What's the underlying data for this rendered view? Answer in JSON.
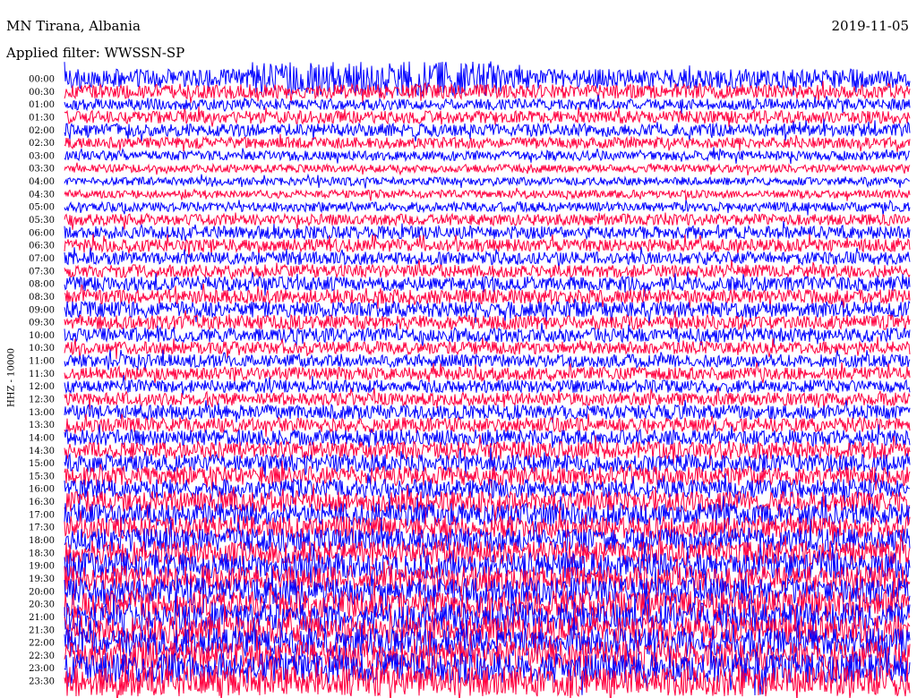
{
  "header": {
    "station": "MN Tirana, Albania",
    "filter": "Applied filter: WWSSN-SP",
    "date": "2019-11-05"
  },
  "chart_data": {
    "type": "line",
    "title": "MN Tirana, Albania",
    "subtitle": "Applied filter: WWSSN-SP",
    "date": "2019-11-05",
    "ylabel": "HHZ - 10000",
    "colors": [
      "#0000ff",
      "#ff0040"
    ],
    "rows": [
      {
        "label": "00:00",
        "amplitude": 0.6
      },
      {
        "label": "00:30",
        "amplitude": 0.45
      },
      {
        "label": "01:00",
        "amplitude": 0.35
      },
      {
        "label": "01:30",
        "amplitude": 0.4
      },
      {
        "label": "02:00",
        "amplitude": 0.4
      },
      {
        "label": "02:30",
        "amplitude": 0.35
      },
      {
        "label": "03:00",
        "amplitude": 0.3
      },
      {
        "label": "03:30",
        "amplitude": 0.25
      },
      {
        "label": "04:00",
        "amplitude": 0.25
      },
      {
        "label": "04:30",
        "amplitude": 0.25
      },
      {
        "label": "05:00",
        "amplitude": 0.3
      },
      {
        "label": "05:30",
        "amplitude": 0.35
      },
      {
        "label": "06:00",
        "amplitude": 0.4
      },
      {
        "label": "06:30",
        "amplitude": 0.4
      },
      {
        "label": "07:00",
        "amplitude": 0.4
      },
      {
        "label": "07:30",
        "amplitude": 0.4
      },
      {
        "label": "08:00",
        "amplitude": 0.45
      },
      {
        "label": "08:30",
        "amplitude": 0.45
      },
      {
        "label": "09:00",
        "amplitude": 0.5
      },
      {
        "label": "09:30",
        "amplitude": 0.45
      },
      {
        "label": "10:00",
        "amplitude": 0.45
      },
      {
        "label": "10:30",
        "amplitude": 0.4
      },
      {
        "label": "11:00",
        "amplitude": 0.4
      },
      {
        "label": "11:30",
        "amplitude": 0.4
      },
      {
        "label": "12:00",
        "amplitude": 0.4
      },
      {
        "label": "12:30",
        "amplitude": 0.4
      },
      {
        "label": "13:00",
        "amplitude": 0.45
      },
      {
        "label": "13:30",
        "amplitude": 0.45
      },
      {
        "label": "14:00",
        "amplitude": 0.5
      },
      {
        "label": "14:30",
        "amplitude": 0.55
      },
      {
        "label": "15:00",
        "amplitude": 0.55
      },
      {
        "label": "15:30",
        "amplitude": 0.6
      },
      {
        "label": "16:00",
        "amplitude": 0.6
      },
      {
        "label": "16:30",
        "amplitude": 0.65
      },
      {
        "label": "17:00",
        "amplitude": 0.7
      },
      {
        "label": "17:30",
        "amplitude": 0.7
      },
      {
        "label": "18:00",
        "amplitude": 0.75
      },
      {
        "label": "18:30",
        "amplitude": 0.75
      },
      {
        "label": "19:00",
        "amplitude": 0.8
      },
      {
        "label": "19:30",
        "amplitude": 0.8
      },
      {
        "label": "20:00",
        "amplitude": 0.85
      },
      {
        "label": "20:30",
        "amplitude": 0.85
      },
      {
        "label": "21:00",
        "amplitude": 0.9
      },
      {
        "label": "21:30",
        "amplitude": 0.9
      },
      {
        "label": "22:00",
        "amplitude": 0.9
      },
      {
        "label": "22:30",
        "amplitude": 0.9
      },
      {
        "label": "23:00",
        "amplitude": 0.95
      },
      {
        "label": "23:30",
        "amplitude": 0.95
      }
    ]
  }
}
